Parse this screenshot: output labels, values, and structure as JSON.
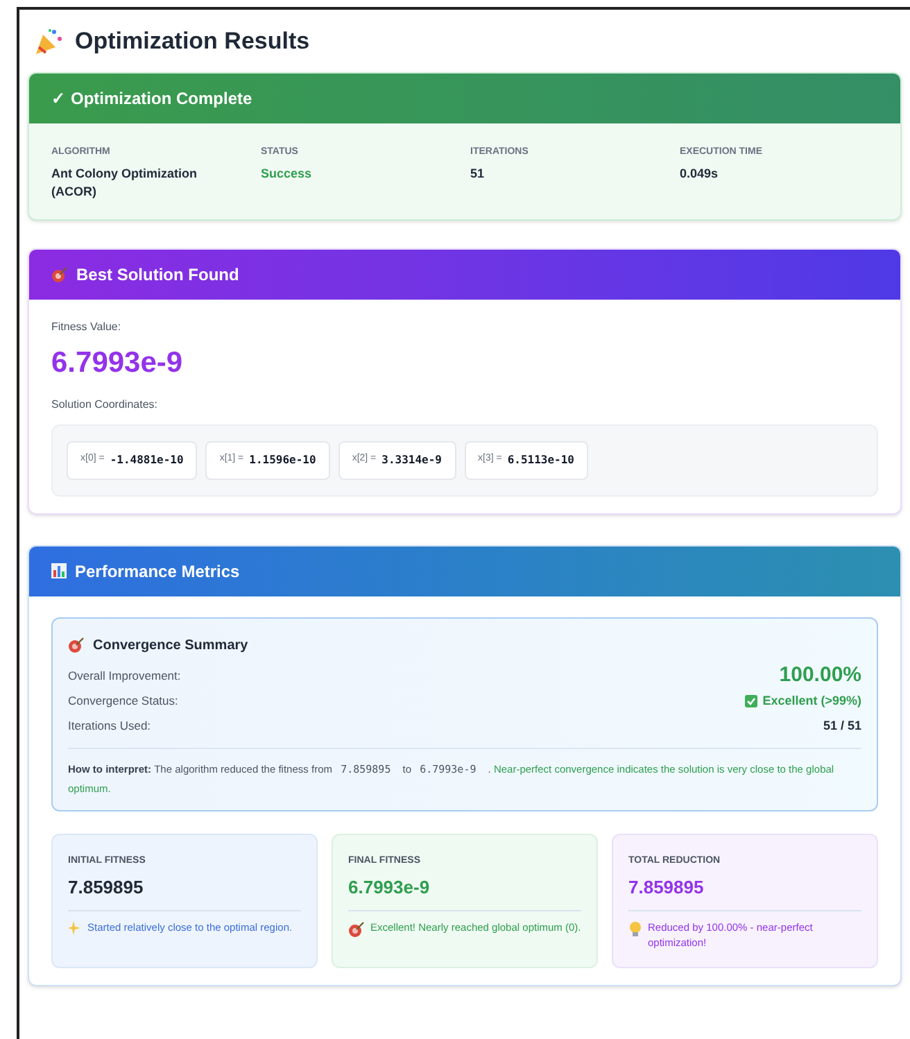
{
  "title": "Optimization Results",
  "complete": {
    "check": "✓",
    "title": "Optimization Complete",
    "fields": [
      {
        "label": "ALGORITHM",
        "value": "Ant Colony Optimization (ACOR)",
        "kind": "plain"
      },
      {
        "label": "STATUS",
        "value": "Success",
        "kind": "success"
      },
      {
        "label": "ITERATIONS",
        "value": "51",
        "kind": "plain"
      },
      {
        "label": "EXECUTION TIME",
        "value": "0.049s",
        "kind": "plain"
      }
    ]
  },
  "best": {
    "title": "Best Solution Found",
    "fitness_label": "Fitness Value:",
    "fitness": "6.7993e-9",
    "coords_label": "Solution Coordinates:",
    "coords": [
      {
        "name": "x[0] =",
        "value": "-1.4881e-10"
      },
      {
        "name": "x[1] =",
        "value": "1.1596e-10"
      },
      {
        "name": "x[2] =",
        "value": "3.3314e-9"
      },
      {
        "name": "x[3] =",
        "value": "6.5113e-10"
      }
    ]
  },
  "metrics": {
    "title": "Performance Metrics",
    "summary": {
      "title": "Convergence Summary",
      "rows": [
        {
          "label": "Overall Improvement:",
          "value": "100.00%",
          "kind": "big"
        },
        {
          "label": "Convergence Status:",
          "value": "Excellent (>99%)",
          "kind": "status"
        },
        {
          "label": "Iterations Used:",
          "value": "51 / 51",
          "kind": "plain"
        }
      ],
      "interpret": [
        {
          "kind": "bold",
          "text": "How to interpret:"
        },
        {
          "kind": "text",
          "text": "The algorithm reduced the fitness from"
        },
        {
          "kind": "code",
          "text": "7.859895"
        },
        {
          "kind": "text",
          "text": "to"
        },
        {
          "kind": "code",
          "text": "6.7993e-9"
        },
        {
          "kind": "text",
          "text": "."
        },
        {
          "kind": "good",
          "text": "Near-perfect convergence indicates the solution is very close to the global optimum."
        }
      ]
    },
    "cards": [
      {
        "kind": "blue",
        "label": "INITIAL FITNESS",
        "value": "7.859895",
        "note": "Started relatively close to the optimal region."
      },
      {
        "kind": "green",
        "label": "FINAL FITNESS",
        "value": "6.7993e-9",
        "note": "Excellent! Nearly reached global optimum (0)."
      },
      {
        "kind": "purple",
        "label": "TOTAL REDUCTION",
        "value": "7.859895",
        "note": "Reduced by 100.00% - near-perfect optimization!"
      }
    ]
  }
}
